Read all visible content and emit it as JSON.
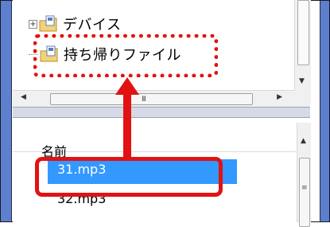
{
  "tree": {
    "items": [
      {
        "label": "デバイス",
        "icon": "folder-device-icon",
        "expander": "+"
      },
      {
        "label": "持ち帰りファイル",
        "icon": "folder-takehome-icon"
      }
    ],
    "hscroll_grip": "III"
  },
  "list": {
    "column_header": "名前",
    "rows": [
      {
        "name": "31.mp3",
        "selected": true
      },
      {
        "name": "32.mp3",
        "selected": false
      }
    ],
    "vscroll_grip": "≡"
  },
  "annotations": {
    "highlight_color": "#e21212",
    "selection_color": "#3399ff"
  }
}
